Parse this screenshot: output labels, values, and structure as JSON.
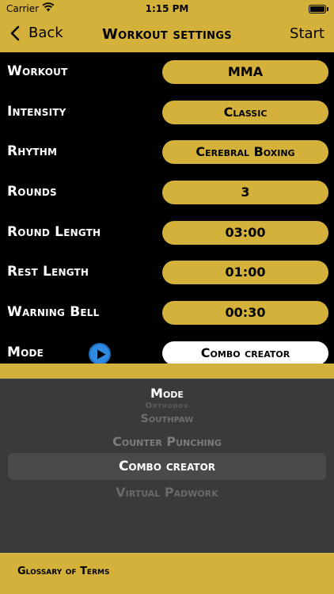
{
  "status": {
    "carrier": "Carrier",
    "time": "1:15 PM"
  },
  "nav": {
    "back": "Back",
    "title": "Workout settings",
    "start": "Start"
  },
  "settings": {
    "workout": {
      "label": "Workout",
      "value": "MMA"
    },
    "intensity": {
      "label": "Intensity",
      "value": "Classic"
    },
    "rhythm": {
      "label": "Rhythm",
      "value": "Cerebral Boxing"
    },
    "rounds": {
      "label": "Rounds",
      "value": "3"
    },
    "round_length": {
      "label": "Round Length",
      "value": "03:00"
    },
    "rest_length": {
      "label": "Rest Length",
      "value": "01:00"
    },
    "warning_bell": {
      "label": "Warning Bell",
      "value": "00:30"
    },
    "mode": {
      "label": "Mode",
      "value": "Combo creator"
    }
  },
  "picker": {
    "title": "Mode",
    "options": [
      "Orthodox",
      "Southpaw",
      "Counter Punching",
      "Combo creator",
      "Virtual Padwork"
    ],
    "selected": "Combo creator"
  },
  "footer": {
    "glossary": "Glossary of Terms"
  },
  "colors": {
    "accent": "#d4b13a",
    "background": "#000000",
    "picker_bg": "#3a3a3a",
    "play": "#2f8ae0"
  }
}
